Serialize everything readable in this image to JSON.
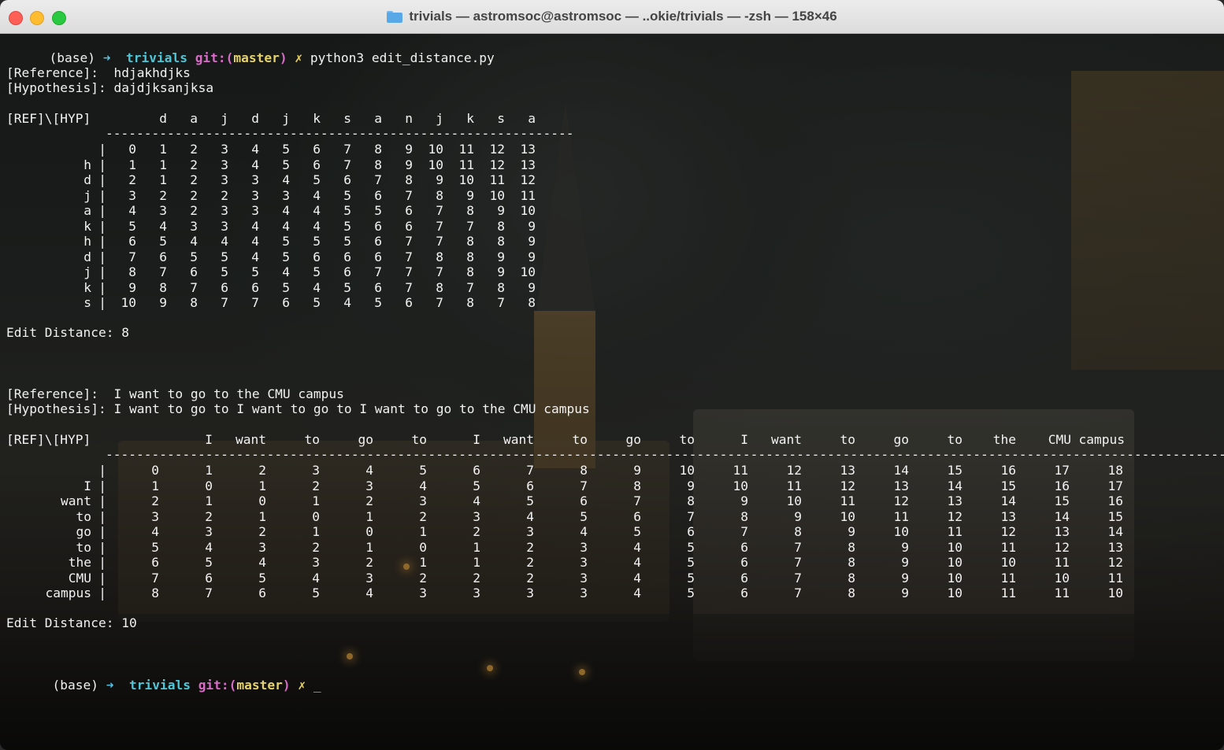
{
  "window": {
    "title": "trivials — astromsoc@astromsoc — ..okie/trivials — -zsh — 158×46"
  },
  "prompt": {
    "env": "(base)",
    "arrow": "➜",
    "dir": "trivials",
    "git": "git:(",
    "branch": "master",
    "git_close": ")",
    "dirty": "✗"
  },
  "first_command": "python3 edit_distance.py",
  "example1": {
    "reference_label": "[Reference]:",
    "reference": "hdjakhdjks",
    "hypothesis_label": "[Hypothesis]:",
    "hypothesis": "dajdjksanjksa",
    "table_header_label": "[REF]\\[HYP]",
    "hyp_tokens": [
      "d",
      "a",
      "j",
      "d",
      "j",
      "k",
      "s",
      "a",
      "n",
      "j",
      "k",
      "s",
      "a"
    ],
    "separator": "-------------------------------------------------------------",
    "ref_tokens": [
      "",
      "h",
      "d",
      "j",
      "a",
      "k",
      "h",
      "d",
      "j",
      "k",
      "s"
    ],
    "matrix": [
      [
        0,
        1,
        2,
        3,
        4,
        5,
        6,
        7,
        8,
        9,
        10,
        11,
        12,
        13
      ],
      [
        1,
        1,
        2,
        3,
        4,
        5,
        6,
        7,
        8,
        9,
        10,
        11,
        12,
        13
      ],
      [
        2,
        1,
        2,
        3,
        3,
        4,
        5,
        6,
        7,
        8,
        9,
        10,
        11,
        12
      ],
      [
        3,
        2,
        2,
        2,
        3,
        3,
        4,
        5,
        6,
        7,
        8,
        9,
        10,
        11
      ],
      [
        4,
        3,
        2,
        3,
        3,
        4,
        4,
        5,
        5,
        6,
        7,
        8,
        9,
        10
      ],
      [
        5,
        4,
        3,
        3,
        4,
        4,
        4,
        5,
        6,
        6,
        7,
        7,
        8,
        9
      ],
      [
        6,
        5,
        4,
        4,
        4,
        5,
        5,
        5,
        6,
        7,
        7,
        8,
        8,
        9
      ],
      [
        7,
        6,
        5,
        5,
        4,
        5,
        6,
        6,
        6,
        7,
        8,
        8,
        9,
        9
      ],
      [
        8,
        7,
        6,
        5,
        5,
        4,
        5,
        6,
        7,
        7,
        7,
        8,
        9,
        10
      ],
      [
        9,
        8,
        7,
        6,
        6,
        5,
        4,
        5,
        6,
        7,
        8,
        7,
        8,
        9
      ],
      [
        10,
        9,
        8,
        7,
        7,
        6,
        5,
        4,
        5,
        6,
        7,
        8,
        7,
        8
      ]
    ],
    "result_label": "Edit Distance:",
    "result": "8"
  },
  "example2": {
    "reference_label": "[Reference]:",
    "reference": "I want to go to the CMU campus",
    "hypothesis_label": "[Hypothesis]:",
    "hypothesis": "I want to go to I want to go to I want to go to the CMU campus",
    "table_header_label": "[REF]\\[HYP]",
    "hyp_tokens": [
      "I",
      "want",
      "to",
      "go",
      "to",
      "I",
      "want",
      "to",
      "go",
      "to",
      "I",
      "want",
      "to",
      "go",
      "to",
      "the",
      "CMU",
      "campus"
    ],
    "separator": "---------------------------------------------------------------------------------------------------------------------------------------------------------------",
    "ref_tokens": [
      "",
      "I",
      "want",
      "to",
      "go",
      "to",
      "the",
      "CMU",
      "campus"
    ],
    "matrix": [
      [
        0,
        1,
        2,
        3,
        4,
        5,
        6,
        7,
        8,
        9,
        10,
        11,
        12,
        13,
        14,
        15,
        16,
        17,
        18
      ],
      [
        1,
        0,
        1,
        2,
        3,
        4,
        5,
        6,
        7,
        8,
        9,
        10,
        11,
        12,
        13,
        14,
        15,
        16,
        17
      ],
      [
        2,
        1,
        0,
        1,
        2,
        3,
        4,
        5,
        6,
        7,
        8,
        9,
        10,
        11,
        12,
        13,
        14,
        15,
        16
      ],
      [
        3,
        2,
        1,
        0,
        1,
        2,
        3,
        4,
        5,
        6,
        7,
        8,
        9,
        10,
        11,
        12,
        13,
        14,
        15
      ],
      [
        4,
        3,
        2,
        1,
        0,
        1,
        2,
        3,
        4,
        5,
        6,
        7,
        8,
        9,
        10,
        11,
        12,
        13,
        14
      ],
      [
        5,
        4,
        3,
        2,
        1,
        0,
        1,
        2,
        3,
        4,
        5,
        6,
        7,
        8,
        9,
        10,
        11,
        12,
        13
      ],
      [
        6,
        5,
        4,
        3,
        2,
        1,
        1,
        2,
        3,
        4,
        5,
        6,
        7,
        8,
        9,
        10,
        10,
        11,
        12
      ],
      [
        7,
        6,
        5,
        4,
        3,
        2,
        2,
        2,
        3,
        4,
        5,
        6,
        7,
        8,
        9,
        10,
        11,
        10,
        11
      ],
      [
        8,
        7,
        6,
        5,
        4,
        3,
        3,
        3,
        3,
        4,
        5,
        6,
        7,
        8,
        9,
        10,
        11,
        11,
        10
      ]
    ],
    "result_label": "Edit Distance:",
    "result": "10"
  },
  "final_cursor": "_"
}
